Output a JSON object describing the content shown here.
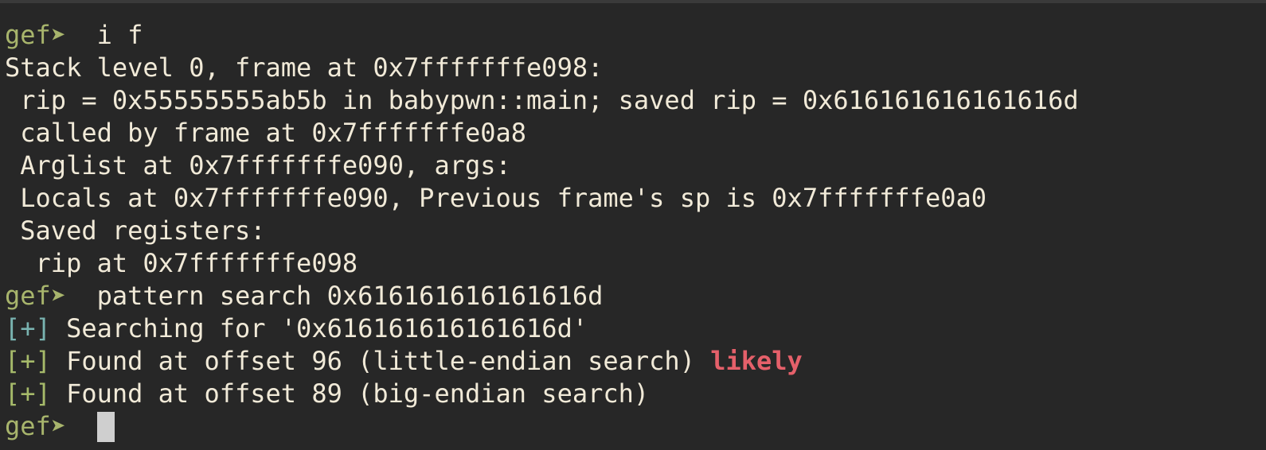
{
  "prompt": "gef➤",
  "lines": {
    "cmd1": "  i f",
    "l1": "Stack level 0, frame at 0x7fffffffe098:",
    "l2": " rip = 0x55555555ab5b in babypwn::main; saved rip = 0x616161616161616d",
    "l3": " called by frame at 0x7fffffffe0a8",
    "l4": " Arglist at 0x7fffffffe090, args: ",
    "l5": " Locals at 0x7fffffffe090, Previous frame's sp is 0x7fffffffe0a0",
    "l6": " Saved registers:",
    "l7": "  rip at 0x7fffffffe098",
    "cmd2": "  pattern search 0x616161616161616d",
    "marker": "[+]",
    "r1": " Searching for '0x616161616161616d'",
    "r2": " Found at offset 96 (little-endian search) ",
    "r2_highlight": "likely",
    "r3": " Found at offset 89 (big-endian search)",
    "cmd3": "  "
  },
  "colors": {
    "background": "#272727",
    "text": "#f1ead8",
    "prompt": "#a8b56c",
    "info_marker": "#79b3b0",
    "success_marker": "#a6ba6a",
    "highlight": "#e5606a"
  }
}
